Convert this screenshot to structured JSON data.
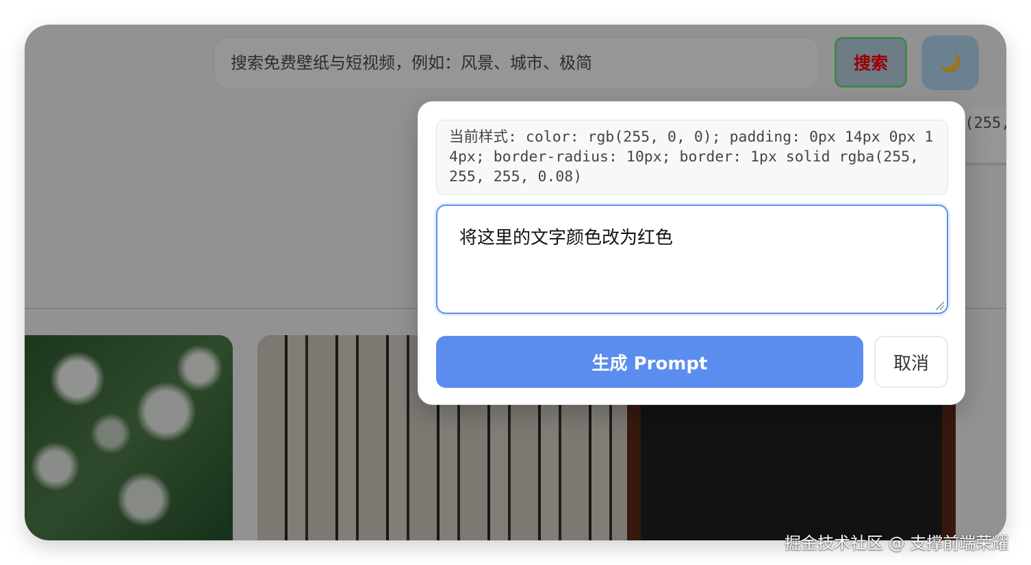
{
  "header": {
    "search_placeholder": "搜索免费壁纸与短视频，例如：风景、城市、极简",
    "search_button_label": "搜索",
    "theme_toggle_icon": "moon-icon",
    "theme_toggle_glyph": "🌙"
  },
  "background": {
    "partial_style_text": "b(255,"
  },
  "popup": {
    "current_style_text": "当前样式: color: rgb(255, 0, 0); padding: 0px 14px 0px 14px; border-radius: 10px; border: 1px solid rgba(255, 255, 255, 0.08)",
    "prompt_value": "将这里的文字颜色改为红色",
    "generate_button_label": "生成 Prompt",
    "cancel_button_label": "取消"
  },
  "watermark": "掘金技术社区 @ 支撑前端荣耀",
  "colors": {
    "accent_blue": "#5b8def",
    "search_text_red": "#ff0000",
    "search_outline_green": "#6fe07a"
  }
}
